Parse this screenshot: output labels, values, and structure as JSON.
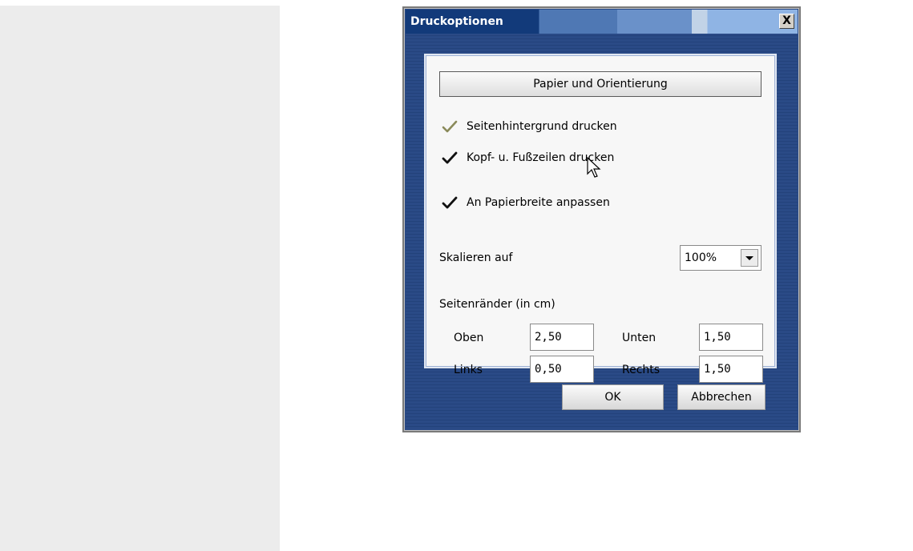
{
  "dialog": {
    "title": "Druckoptionen",
    "close_label": "X",
    "paper_button": "Papier und Orientierung",
    "checkboxes": [
      {
        "label": "Seitenhintergrund drucken",
        "checked": true
      },
      {
        "label": "Kopf- u. Fußzeilen drucken",
        "checked": true
      },
      {
        "label": "An Papierbreite anpassen",
        "checked": true
      }
    ],
    "scale": {
      "label": "Skalieren auf",
      "value": "100%"
    },
    "margins": {
      "heading": "Seitenränder (in cm)",
      "top_label": "Oben",
      "top_value": "2,50",
      "bottom_label": "Unten",
      "bottom_value": "1,50",
      "left_label": "Links",
      "left_value": "0,50",
      "right_label": "Rechts",
      "right_value": "1,50"
    },
    "ok_button": "OK",
    "cancel_button": "Abbrechen"
  },
  "icons": {
    "checkmark": "checkmark-icon",
    "dropdown": "chevron-down-icon",
    "cursor": "mouse-pointer-icon"
  },
  "colors": {
    "titlebar": "#123a7a",
    "dialog_frame": "#2a4a86",
    "left_panel": "#ececec"
  }
}
